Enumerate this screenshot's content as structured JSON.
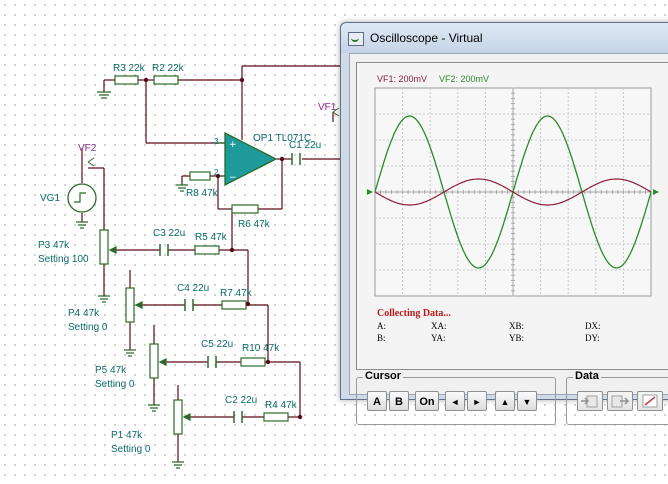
{
  "schematic": {
    "resistors": [
      "R3 22k",
      "R2 22k",
      "R8 47k",
      "R6 47k",
      "R5 47k",
      "R7 47k",
      "R10 47k",
      "R4 47k"
    ],
    "capacitors": [
      "C1 22u",
      "C3 22u",
      "C4 22u",
      "C5 22u",
      "C2 22u"
    ],
    "opamp": "OP1 TL071C",
    "probes": [
      "VF2",
      "VF1"
    ],
    "source": "VG1",
    "pots": [
      {
        "name": "P3 47k",
        "setting": "Setting 100"
      },
      {
        "name": "P4 47k",
        "setting": "Setting 0"
      },
      {
        "name": "P5 47k",
        "setting": "Setting 0"
      },
      {
        "name": "P1 47k",
        "setting": "Setting 0"
      }
    ],
    "pins": [
      "3",
      "2"
    ]
  },
  "scope": {
    "title": "Oscilloscope - Virtual",
    "ch1_label": "VF1: 200mV",
    "ch2_label": "VF2: 200mV",
    "ch1_color": "#8b1f3a",
    "ch2_color": "#2b8a2b",
    "status": "Collecting Data...",
    "readouts": [
      "A:",
      "XA:",
      "XB:",
      "DX:",
      "B:",
      "YA:",
      "YB:",
      "DY:"
    ],
    "cursor_group": "Cursor",
    "cursor_buttons": [
      "A",
      "B",
      "On",
      "◄",
      "►",
      "▲",
      "▼"
    ],
    "data_group": "Data",
    "data_icons": [
      "import-icon",
      "export-icon",
      "graph-icon"
    ]
  }
}
